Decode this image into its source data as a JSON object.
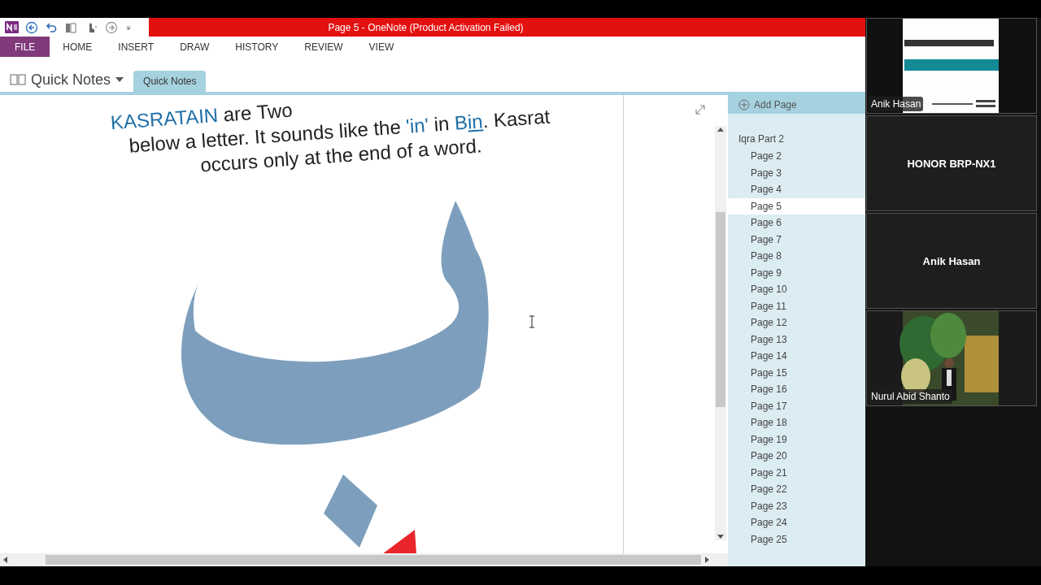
{
  "window": {
    "title": "Page 5 - OneNote (Product Activation Failed)"
  },
  "ribbon_tabs": [
    {
      "label": "FILE",
      "kind": "file"
    },
    {
      "label": "HOME",
      "kind": "tab"
    },
    {
      "label": "INSERT",
      "kind": "tab"
    },
    {
      "label": "DRAW",
      "kind": "tab"
    },
    {
      "label": "HISTORY",
      "kind": "tab"
    },
    {
      "label": "REVIEW",
      "kind": "tab"
    },
    {
      "label": "VIEW",
      "kind": "tab"
    }
  ],
  "notebook": {
    "name": "Quick Notes"
  },
  "section_tabs": [
    {
      "label": "Quick Notes",
      "selected": true
    }
  ],
  "note": {
    "lines": [
      [
        {
          "text": "KASRATAIN",
          "kind": "term"
        },
        {
          "text": " are Two",
          "kind": "plain"
        }
      ],
      [
        {
          "text": "below a letter. It sounds like the ",
          "kind": "plain"
        },
        {
          "text": "'in'",
          "kind": "term"
        },
        {
          "text": " in ",
          "kind": "plain"
        },
        {
          "text": "B",
          "kind": "term"
        },
        {
          "text": "in",
          "kind": "underlined-term"
        },
        {
          "text": ". Kasrat",
          "kind": "plain"
        }
      ],
      [
        {
          "text": "occurs only at the end of a word.",
          "kind": "plain"
        }
      ]
    ]
  },
  "page_panel": {
    "add_label": "Add Page",
    "section": "Iqra Part 2",
    "pages": [
      {
        "label": "Page 2",
        "selected": false
      },
      {
        "label": "Page 3",
        "selected": false
      },
      {
        "label": "Page 4",
        "selected": false
      },
      {
        "label": "Page 5",
        "selected": true
      },
      {
        "label": "Page 6",
        "selected": false
      },
      {
        "label": "Page 7",
        "selected": false
      },
      {
        "label": "Page 8",
        "selected": false
      },
      {
        "label": "Page 9",
        "selected": false
      },
      {
        "label": "Page 10",
        "selected": false
      },
      {
        "label": "Page 11",
        "selected": false
      },
      {
        "label": "Page 12",
        "selected": false
      },
      {
        "label": "Page 13",
        "selected": false
      },
      {
        "label": "Page 14",
        "selected": false
      },
      {
        "label": "Page 15",
        "selected": false
      },
      {
        "label": "Page 16",
        "selected": false
      },
      {
        "label": "Page 17",
        "selected": false
      },
      {
        "label": "Page 18",
        "selected": false
      },
      {
        "label": "Page 19",
        "selected": false
      },
      {
        "label": "Page 20",
        "selected": false
      },
      {
        "label": "Page 21",
        "selected": false
      },
      {
        "label": "Page 22",
        "selected": false
      },
      {
        "label": "Page 23",
        "selected": false
      },
      {
        "label": "Page 24",
        "selected": false
      },
      {
        "label": "Page 25",
        "selected": false
      }
    ]
  },
  "participants": [
    {
      "name": "Anik Hasan",
      "kind": "video"
    },
    {
      "name": "HONOR BRP-NX1",
      "kind": "camera-off"
    },
    {
      "name": "Anik Hasan",
      "kind": "camera-off"
    },
    {
      "name": "Nurul Abid Shanto",
      "kind": "video"
    }
  ]
}
